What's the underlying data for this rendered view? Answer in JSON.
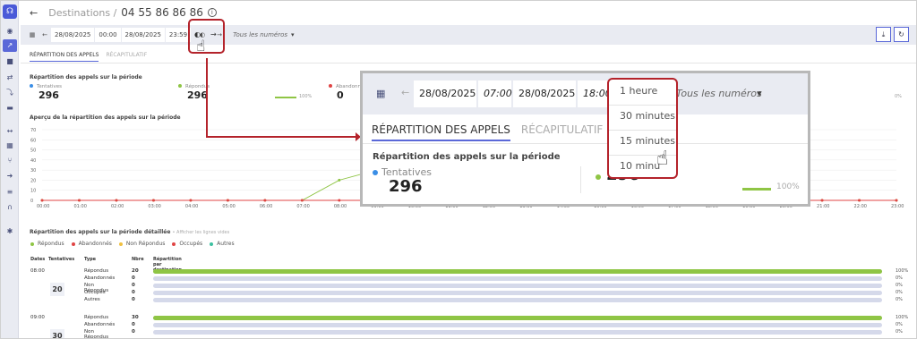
{
  "header": {
    "breadcrumb": "Destinations /",
    "phone": "04 55 86 86 86",
    "back_icon": "arrow-left-icon",
    "info_icon": "info-icon"
  },
  "filter": {
    "date_from": "28/08/2025",
    "time_from": "00:00",
    "date_to": "28/08/2025",
    "time_to": "23:59",
    "numbers": "Tous les numéros"
  },
  "tabs": {
    "active": "RÉPARTITION DES APPELS",
    "inactive": "RÉCAPITULATIF"
  },
  "summary": {
    "title": "Répartition des appels sur la période",
    "tentatives_label": "Tentatives",
    "tentatives_value": "296",
    "repondus_label": "Répondus",
    "repondus_value": "296",
    "repondus_pct": "100%",
    "abandonnes_label": "Abandonn",
    "abandonnes_value": "0",
    "last_pct": "0%"
  },
  "overview": {
    "title": "Aperçu de la répartition des appels sur la période"
  },
  "detail": {
    "title": "Répartition des appels sur la période détaillée",
    "hint": "• Afficher les lignes vides"
  },
  "legend": [
    {
      "label": "Répondus",
      "color": "#8fc545"
    },
    {
      "label": "Abandonnés",
      "color": "#e04444"
    },
    {
      "label": "Non Répondus",
      "color": "#f0c040"
    },
    {
      "label": "Occupés",
      "color": "#e04444"
    },
    {
      "label": "Autres",
      "color": "#3cc0a0"
    }
  ],
  "table": {
    "headers": {
      "dates": "Dates",
      "tentatives": "Tentatives",
      "type": "Type",
      "nbre": "Nbre",
      "repartition": "Répartition par destination"
    },
    "groups": [
      {
        "time": "08:00",
        "tentatives": "20",
        "rows": [
          {
            "type": "Répondus",
            "nbre": "20",
            "pct": "100%",
            "fill": 1
          },
          {
            "type": "Abandonnés",
            "nbre": "0",
            "pct": "0%",
            "fill": 0
          },
          {
            "type": "Non Répondus",
            "nbre": "0",
            "pct": "0%",
            "fill": 0
          },
          {
            "type": "Occupés",
            "nbre": "0",
            "pct": "0%",
            "fill": 0
          },
          {
            "type": "Autres",
            "nbre": "0",
            "pct": "0%",
            "fill": 0
          }
        ]
      },
      {
        "time": "09:00",
        "tentatives": "30",
        "rows": [
          {
            "type": "Répondus",
            "nbre": "30",
            "pct": "100%",
            "fill": 1
          },
          {
            "type": "Abandonnés",
            "nbre": "0",
            "pct": "0%",
            "fill": 0
          },
          {
            "type": "Non Répondus",
            "nbre": "0",
            "pct": "0%",
            "fill": 0
          }
        ]
      }
    ]
  },
  "chart_data": {
    "type": "line",
    "x": [
      "00:00",
      "01:00",
      "02:00",
      "03:00",
      "04:00",
      "05:00",
      "06:00",
      "07:00",
      "08:00",
      "09:00",
      "10:00",
      "11:00",
      "12:00",
      "13:00",
      "14:00",
      "15:00",
      "16:00",
      "17:00",
      "18:00",
      "19:00",
      "20:00",
      "21:00",
      "22:00",
      "23:00"
    ],
    "series": [
      {
        "name": "Répondus",
        "color": "#8fc545",
        "values": [
          0,
          0,
          0,
          0,
          0,
          0,
          0,
          0,
          20,
          30,
          null,
          null,
          null,
          null,
          null,
          null,
          null,
          null,
          null,
          0,
          0,
          0,
          0,
          0
        ]
      },
      {
        "name": "Abandonnés",
        "color": "#e04444",
        "values": [
          0,
          0,
          0,
          0,
          0,
          0,
          0,
          0,
          0,
          0,
          null,
          null,
          null,
          null,
          null,
          null,
          null,
          null,
          null,
          0,
          0,
          0,
          0,
          0
        ]
      }
    ],
    "yticks": [
      0,
      10,
      20,
      30,
      40,
      50,
      60,
      70
    ],
    "ylim": [
      0,
      70
    ]
  },
  "zoom": {
    "date_from": "28/08/2025",
    "time_from": "07:00",
    "date_to": "28/08/2025",
    "time_to": "18:00",
    "numbers": "Tous les numéros",
    "tab_active": "RÉPARTITION DES APPELS",
    "tab_inactive": "RÉCAPITULATIF",
    "title": "Répartition des appels sur la période",
    "tentatives_label": "Tentatives",
    "tentatives_value": "296",
    "repondus_value": "296",
    "repondus_pct": "100%"
  },
  "dropdown": {
    "items": [
      "1 heure",
      "30 minutes",
      "15 minutes",
      "10 minu"
    ]
  }
}
